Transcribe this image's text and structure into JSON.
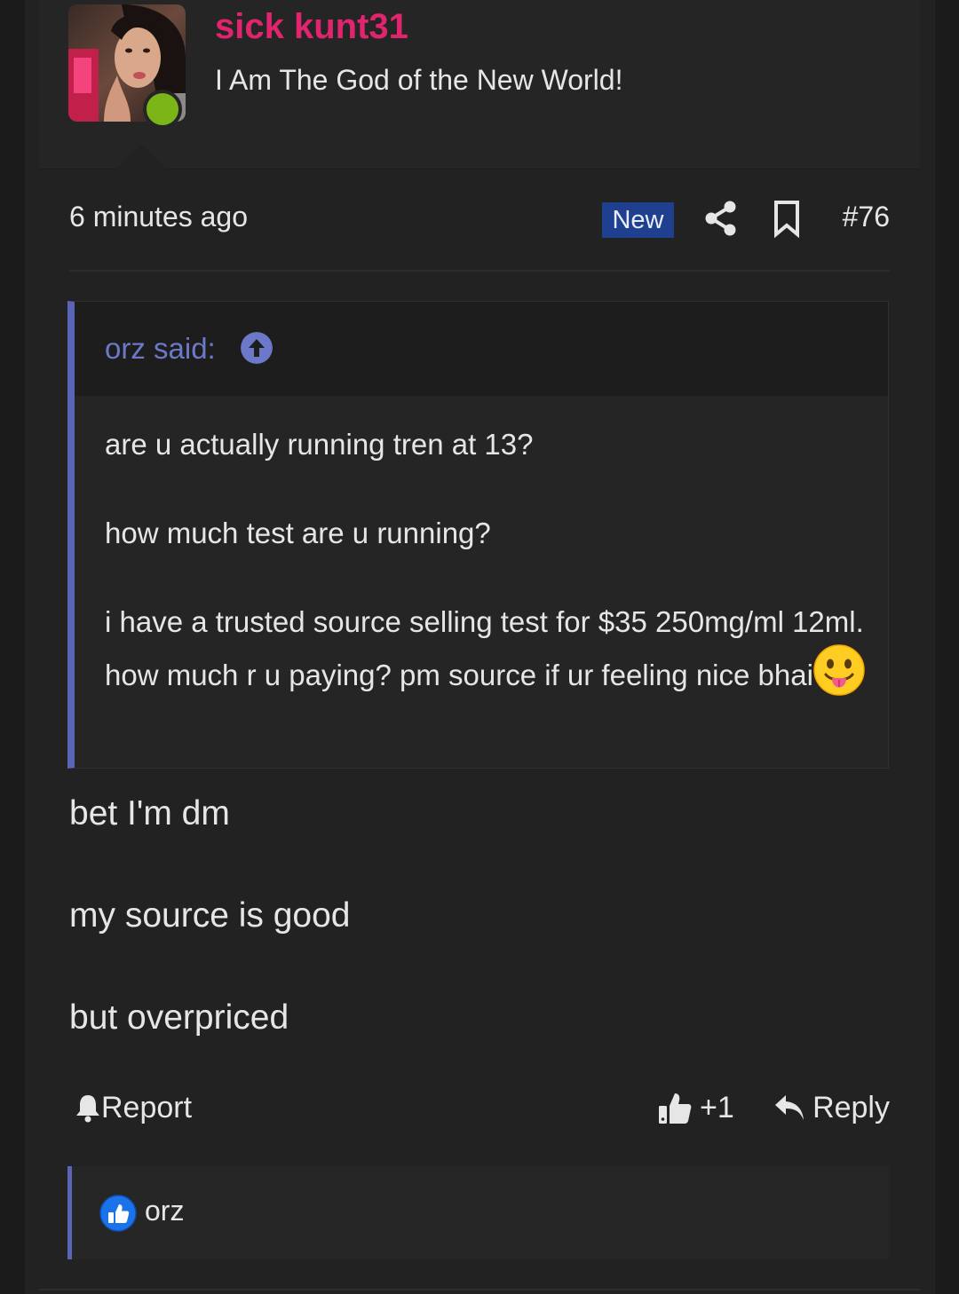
{
  "user": {
    "name": "sick kunt31",
    "title": "I Am The God of the New World!",
    "online": true,
    "name_color": "#e0246e",
    "online_color": "#7cb518"
  },
  "post": {
    "time": "6 minutes ago",
    "new_badge": "New",
    "number": "#76",
    "icons": [
      "share-icon",
      "bookmark-icon"
    ]
  },
  "quote": {
    "author": "orz said:",
    "accent_color": "#5b65b5",
    "paragraphs": [
      "are u actually running tren at 13?",
      "how much test are u running?",
      "i have a trusted source selling test for $35 250mg/ml 12ml. how much r u paying? pm source if ur feeling nice bhai"
    ],
    "emoji": "face-with-tongue-emoji"
  },
  "message": {
    "paragraphs": [
      "bet I'm dm",
      "my source is good",
      "but overpriced"
    ]
  },
  "actions": {
    "report": "Report",
    "like": "+1",
    "reply": "Reply"
  },
  "reactions": {
    "icon": "like-reaction-icon",
    "users": "orz"
  }
}
